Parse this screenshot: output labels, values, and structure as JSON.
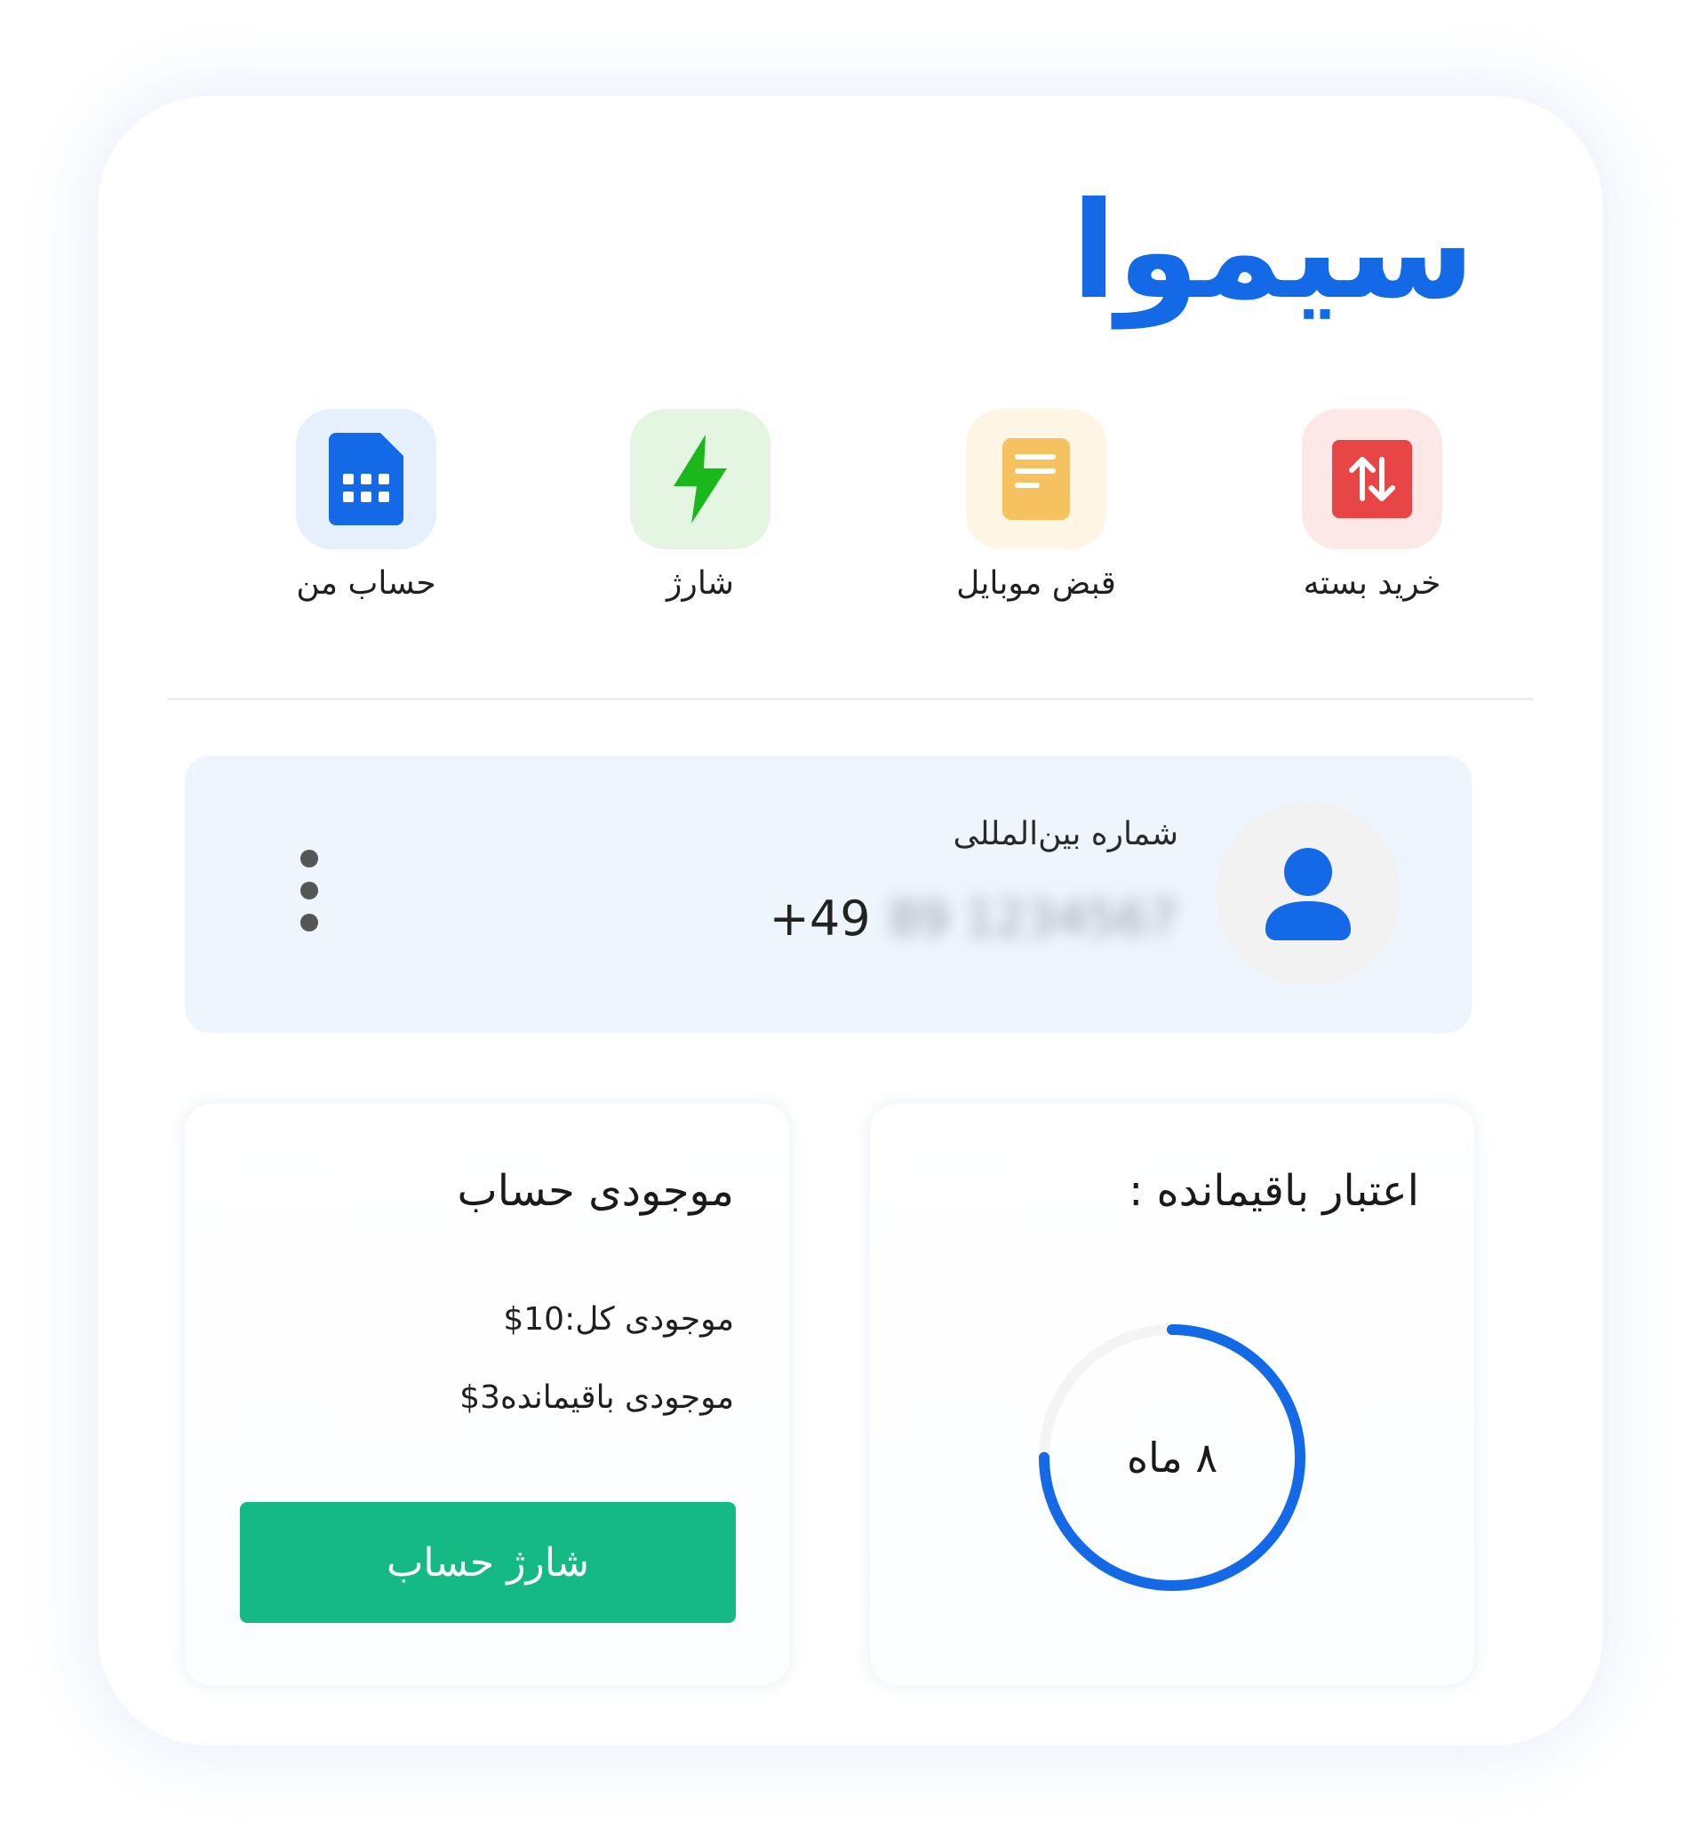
{
  "brand": {
    "name": "سیموا",
    "color": "#1369e6"
  },
  "actions": [
    {
      "label": "حساب من",
      "icon": "sim-card-icon",
      "color": "#1369e6",
      "bg": "#e6f0fd"
    },
    {
      "label": "شارژ",
      "icon": "lightning-icon",
      "color": "#1ab81a",
      "bg": "#e4f6e2"
    },
    {
      "label": "قبض موبایل",
      "icon": "bill-icon",
      "color": "#f6c260",
      "bg": "#fef5e4"
    },
    {
      "label": "خرید بسته",
      "icon": "swap-arrows-icon",
      "color": "#e84646",
      "bg": "#fde8e8"
    }
  ],
  "number_card": {
    "label": "شماره بین‌المللی",
    "country_code": "+49",
    "number_hidden": "89 1234567"
  },
  "balance": {
    "title": "موجودی حساب",
    "total": "موجودی کل:10$",
    "remaining": "موجودی باقیمانده3$",
    "charge_button": "شارژ حساب"
  },
  "credit": {
    "title": "اعتبار باقیمانده :",
    "value_label": "۸ ماه",
    "progress": 0.75,
    "ring_color": "#1369e6",
    "track_color": "#f4f4f4"
  }
}
